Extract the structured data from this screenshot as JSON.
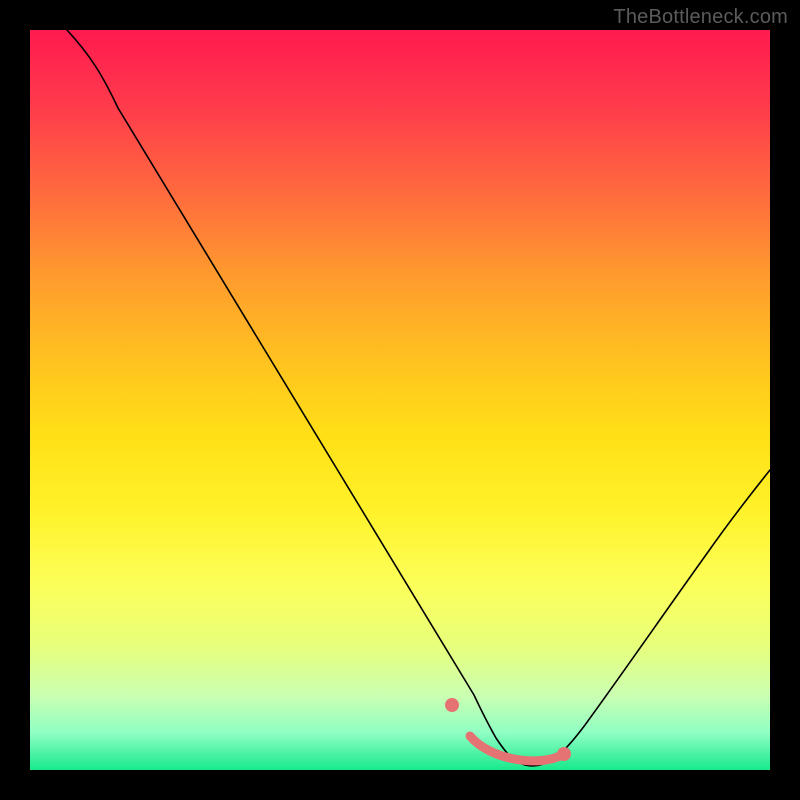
{
  "watermark": "TheBottleneck.com",
  "colors": {
    "bg_frame": "#000000",
    "gradient_top": "#ff1a4f",
    "gradient_bottom": "#17e98b",
    "curve": "#000000",
    "highlight": "#e57373"
  },
  "chart_data": {
    "type": "line",
    "title": "",
    "xlabel": "",
    "ylabel": "",
    "xlim": [
      0,
      100
    ],
    "ylim": [
      0,
      100
    ],
    "grid": false,
    "legend": false,
    "annotation": "TheBottleneck.com",
    "x": [
      5,
      10,
      15,
      20,
      25,
      30,
      35,
      40,
      45,
      50,
      55,
      57,
      60,
      63,
      66,
      70,
      75,
      80,
      85,
      90,
      95,
      100
    ],
    "y": [
      100,
      95,
      87,
      78.5,
      70,
      61,
      52,
      43,
      34,
      25,
      14,
      9,
      3.5,
      1.5,
      0.7,
      0.7,
      1.5,
      4.5,
      11,
      20,
      30,
      40
    ],
    "highlight_segment": {
      "x_start": 57,
      "x_end": 72,
      "y_start": 9,
      "y_end": 2.0
    },
    "note": "x/y are percentages of the plot-area width/height from bottom-left; values estimated from pixels"
  }
}
